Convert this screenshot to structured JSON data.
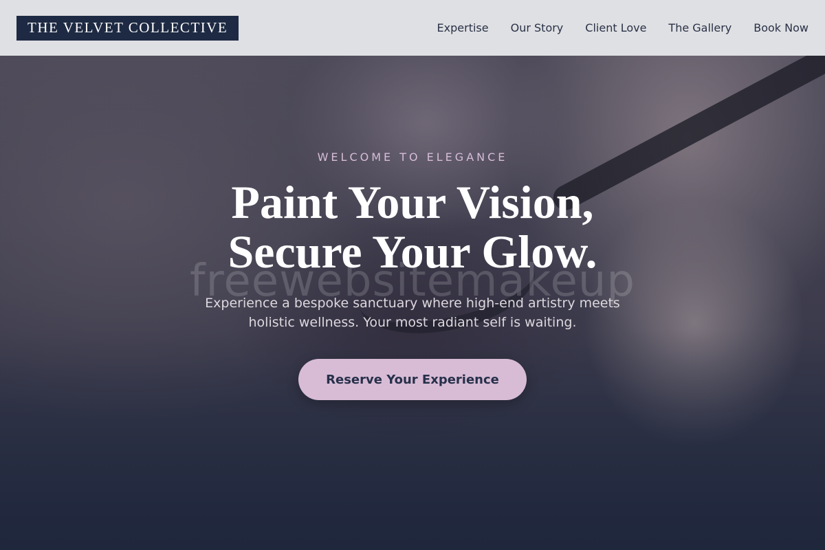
{
  "header": {
    "logo": "THE VELVET COLLECTIVE",
    "nav": [
      "Expertise",
      "Our Story",
      "Client Love",
      "The Gallery",
      "Book Now"
    ]
  },
  "hero": {
    "eyebrow": "WELCOME TO ELEGANCE",
    "headline_line1": "Paint Your Vision,",
    "headline_line2": "Secure Your Glow.",
    "subtext": "Experience a bespoke sanctuary where high-end artistry meets holistic wellness. Your most radiant self is waiting.",
    "cta_label": "Reserve Your Experience",
    "watermark": "freewebsitemakeup",
    "background_image": "makeup-artist-applying-eyelashes-photo"
  },
  "colors": {
    "header_bg": "#dfe0e3",
    "logo_bg": "#1e2a43",
    "nav_text": "#2a3147",
    "eyebrow": "#d6bdd8",
    "cta_bg": "#d8bcd6",
    "cta_text": "#27304a"
  }
}
